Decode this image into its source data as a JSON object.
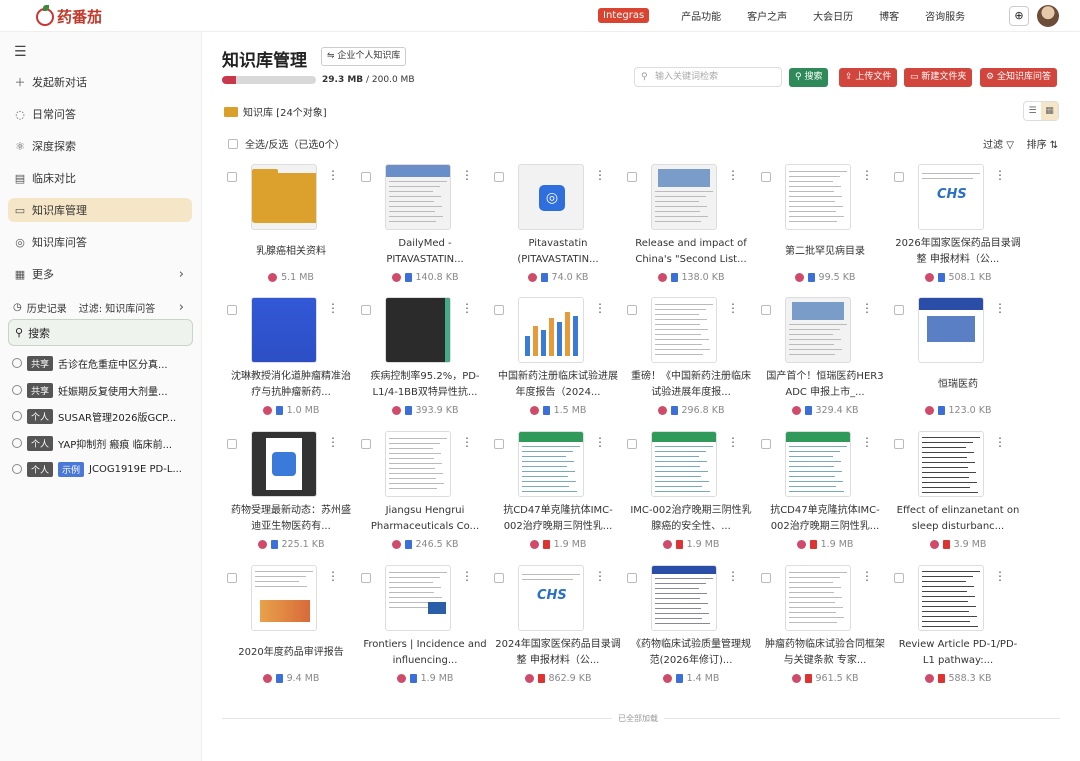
{
  "brand": {
    "name": "药番茄"
  },
  "topnav": {
    "integras": "Integras",
    "items": [
      "产品功能",
      "客户之声",
      "大会日历",
      "博客",
      "咨询服务"
    ]
  },
  "sidebar": {
    "items": [
      {
        "label": "发起新对话",
        "icon": "plus-icon"
      },
      {
        "label": "日常问答",
        "icon": "chat-icon"
      },
      {
        "label": "深度探索",
        "icon": "atom-icon"
      },
      {
        "label": "临床对比",
        "icon": "compare-icon"
      },
      {
        "label": "知识库管理",
        "icon": "kb-icon"
      },
      {
        "label": "知识库问答",
        "icon": "kb-qa-icon"
      },
      {
        "label": "更多",
        "icon": "grid-icon"
      }
    ],
    "history_label": "历史记录",
    "history_filter": "过滤: 知识库问答",
    "search_label": "搜索",
    "history": [
      {
        "tag": "共享",
        "title": "舌诊在危重症中区分真..."
      },
      {
        "tag": "共享",
        "title": "妊娠期反复使用大剂量..."
      },
      {
        "tag": "个人",
        "title": "SUSAR管理2026版GCP..."
      },
      {
        "tag": "个人",
        "title": "YAP抑制剂 瘢痕 临床前..."
      },
      {
        "tag": "个人",
        "tag2": "示例",
        "title": "JCOG1919E PD-L..."
      }
    ]
  },
  "main": {
    "title": "知识库管理",
    "scope_button": "⇋ 企业个人知识库",
    "storage": {
      "used": "29.3 MB",
      "sep": " / ",
      "total": "200.0 MB",
      "fraction": 0.147
    },
    "search_placeholder": "输入关键词检索",
    "buttons": {
      "search": "搜索",
      "upload": "上传文件",
      "new_folder": "新建文件夹",
      "kb_qa": "全知识库问答"
    },
    "breadcrumb": "知识库 [24个对象]",
    "select_all": "全选/反选（已选0个）",
    "filter": "过滤",
    "sort": "排序",
    "footer": "已全部加载"
  },
  "cards": [
    {
      "name": "乳腺癌相关资料",
      "size": "5.1 MB",
      "type": "folder",
      "thumb": "folder"
    },
    {
      "name": "DailyMed - PITAVASTATIN...",
      "size": "140.8 KB",
      "type": "doc",
      "thumb": "blue-doc"
    },
    {
      "name": "Pitavastatin (PITAVASTATIN...",
      "size": "74.0 KB",
      "type": "doc",
      "thumb": "globe"
    },
    {
      "name": "Release and impact of China's \"Second List...",
      "size": "138.0 KB",
      "type": "doc",
      "thumb": "web"
    },
    {
      "name": "第二批罕见病目录",
      "size": "99.5 KB",
      "type": "doc",
      "thumb": "text"
    },
    {
      "name": "2026年国家医保药品目录调整 申报材料（公...",
      "size": "508.1 KB",
      "type": "doc",
      "thumb": "chs"
    },
    {
      "name": "沈琳教授消化道肿瘤精准治疗与抗肿瘤新药...",
      "size": "1.0 MB",
      "type": "doc",
      "thumb": "blue-solid"
    },
    {
      "name": "疾病控制率95.2%，PD-L1/4-1BB双特异性抗...",
      "size": "393.9 KB",
      "type": "doc",
      "thumb": "dark"
    },
    {
      "name": "中国新药注册临床试验进展年度报告（2024...",
      "size": "1.5 MB",
      "type": "doc",
      "thumb": "bars"
    },
    {
      "name": "重磅！《中国新药注册临床试验进展年度报...",
      "size": "296.8 KB",
      "type": "doc",
      "thumb": "text"
    },
    {
      "name": "国产首个！恒瑞医药HER3 ADC 申报上市_...",
      "size": "329.4 KB",
      "type": "doc",
      "thumb": "web"
    },
    {
      "name": "恒瑞医药",
      "size": "123.0 KB",
      "type": "doc",
      "thumb": "hengrui"
    },
    {
      "name": "药物受理最新动态：苏州盛迪亚生物医药有...",
      "size": "225.1 KB",
      "type": "doc",
      "thumb": "phone"
    },
    {
      "name": "Jiangsu Hengrui Pharmaceuticals Co...",
      "size": "246.5 KB",
      "type": "doc",
      "thumb": "text"
    },
    {
      "name": "抗CD47单克隆抗体IMC-002治疗晚期三阴性乳...",
      "size": "1.9 MB",
      "type": "pdf",
      "thumb": "green-table"
    },
    {
      "name": "IMC-002治疗晚期三阴性乳腺癌的安全性、...",
      "size": "1.9 MB",
      "type": "pdf",
      "thumb": "green-table"
    },
    {
      "name": "抗CD47单克隆抗体IMC-002治疗晚期三阴性乳...",
      "size": "1.9 MB",
      "type": "pdf",
      "thumb": "green-table"
    },
    {
      "name": "Effect of elinzanetant on sleep disturbanc...",
      "size": "3.9 MB",
      "type": "pdf",
      "thumb": "paper"
    },
    {
      "name": "2020年度药品审评报告",
      "size": "9.4 MB",
      "type": "doc",
      "thumb": "chart-doc"
    },
    {
      "name": "Frontiers | Incidence and influencing...",
      "size": "1.9 MB",
      "type": "doc",
      "thumb": "frontiers"
    },
    {
      "name": "2024年国家医保药品目录调整 申报材料（公...",
      "size": "862.9 KB",
      "type": "pdf",
      "thumb": "chs"
    },
    {
      "name": "《药物临床试验质量管理规范(2026年修订)...",
      "size": "1.4 MB",
      "type": "doc",
      "thumb": "table-doc"
    },
    {
      "name": "肿瘤药物临床试验合同框架与关键条款 专家...",
      "size": "961.5 KB",
      "type": "pdf",
      "thumb": "text"
    },
    {
      "name": "Review Article PD-1/PD-L1 pathway:...",
      "size": "588.3 KB",
      "type": "pdf",
      "thumb": "paper"
    }
  ]
}
